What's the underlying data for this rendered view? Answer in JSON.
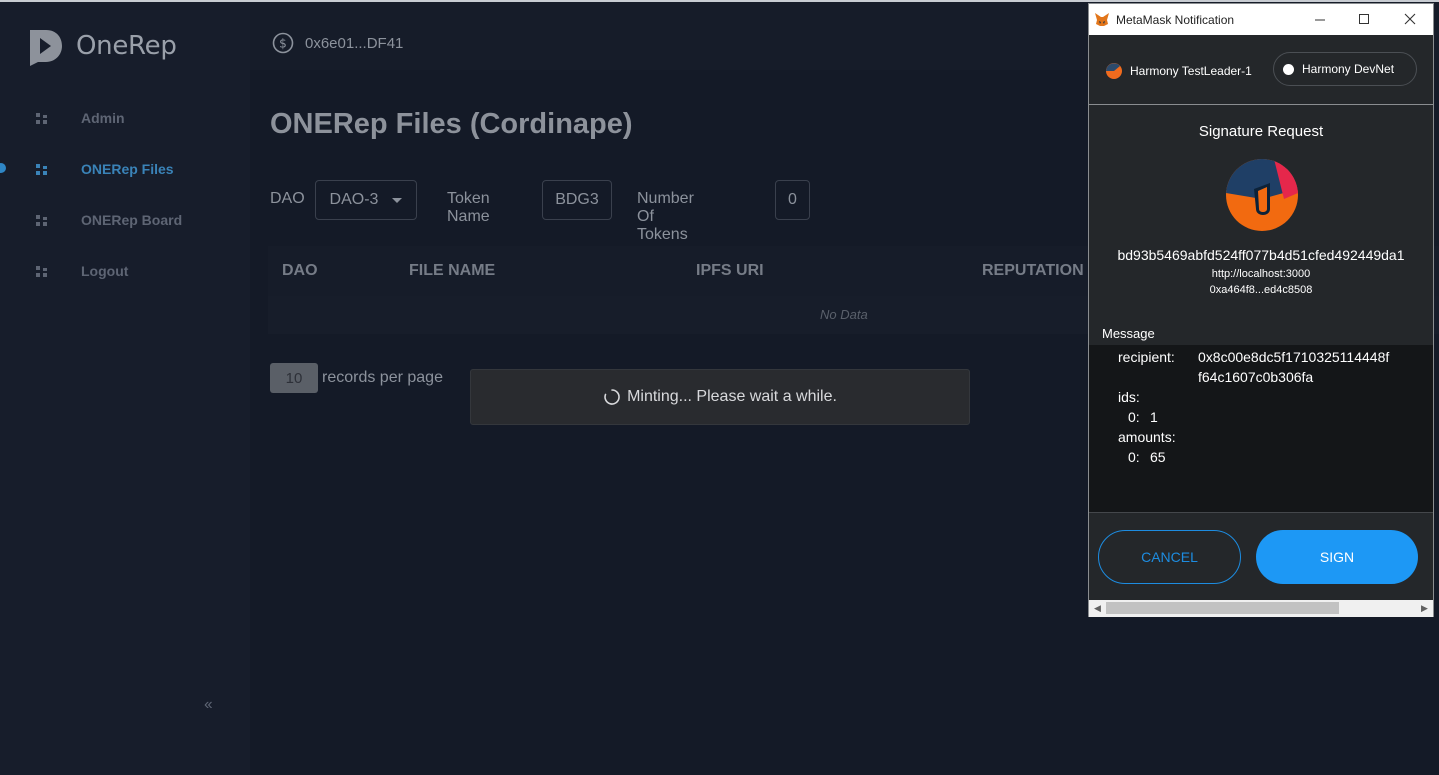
{
  "app": {
    "name": "OneRep"
  },
  "sidebar": {
    "items": [
      {
        "label": "Admin",
        "active": false
      },
      {
        "label": "ONERep Files",
        "active": true
      },
      {
        "label": "ONERep Board",
        "active": false
      },
      {
        "label": "Logout",
        "active": false
      }
    ],
    "collapse_label": "‹‹"
  },
  "header": {
    "wallet_address": "0x6e01...DF41",
    "wallet_icon": "dollar-circle-icon"
  },
  "main": {
    "title": "ONERep Files (Cordinape)",
    "filters": {
      "dao_label": "DAO",
      "dao_value": "DAO-3",
      "token_name_label": "Token Name",
      "token_name_value": "BDG3",
      "num_tokens_label": "Number Of Tokens",
      "num_tokens_value": "0"
    },
    "table": {
      "columns": [
        "DAO",
        "FILE NAME",
        "IPFS URI",
        "REPUTATION"
      ],
      "empty_text": "No Data"
    },
    "pagination": {
      "per_page": "10",
      "per_page_label": "records per page"
    },
    "toast": {
      "text": "Minting... Please wait a while."
    }
  },
  "metamask": {
    "window_title": "MetaMask Notification",
    "network_left": "Harmony TestLeader-1",
    "network_right": "Harmony DevNet",
    "signature_title": "Signature Request",
    "address": "bd93b5469abfd524ff077b4d51cfed492449da1",
    "origin": "http://localhost:3000",
    "account": "0xa464f8...ed4c8508",
    "message_label": "Message",
    "message": {
      "recipient_key": "recipient:",
      "recipient_line1": "0x8c00e8dc5f1710325114448f",
      "recipient_line2": "f64c1607c0b306fa",
      "ids_key": "ids:",
      "ids_0_key": "0:",
      "ids_0_val": "1",
      "amounts_key": "amounts:",
      "amounts_0_key": "0:",
      "amounts_0_val": "65"
    },
    "cancel_label": "CANCEL",
    "sign_label": "SIGN"
  },
  "colors": {
    "background": "#141a27",
    "sidebar": "#171d2b",
    "active_nav": "#3a83b8",
    "metamask_blue": "#1d98f5",
    "metamask_bg": "#24272a"
  }
}
